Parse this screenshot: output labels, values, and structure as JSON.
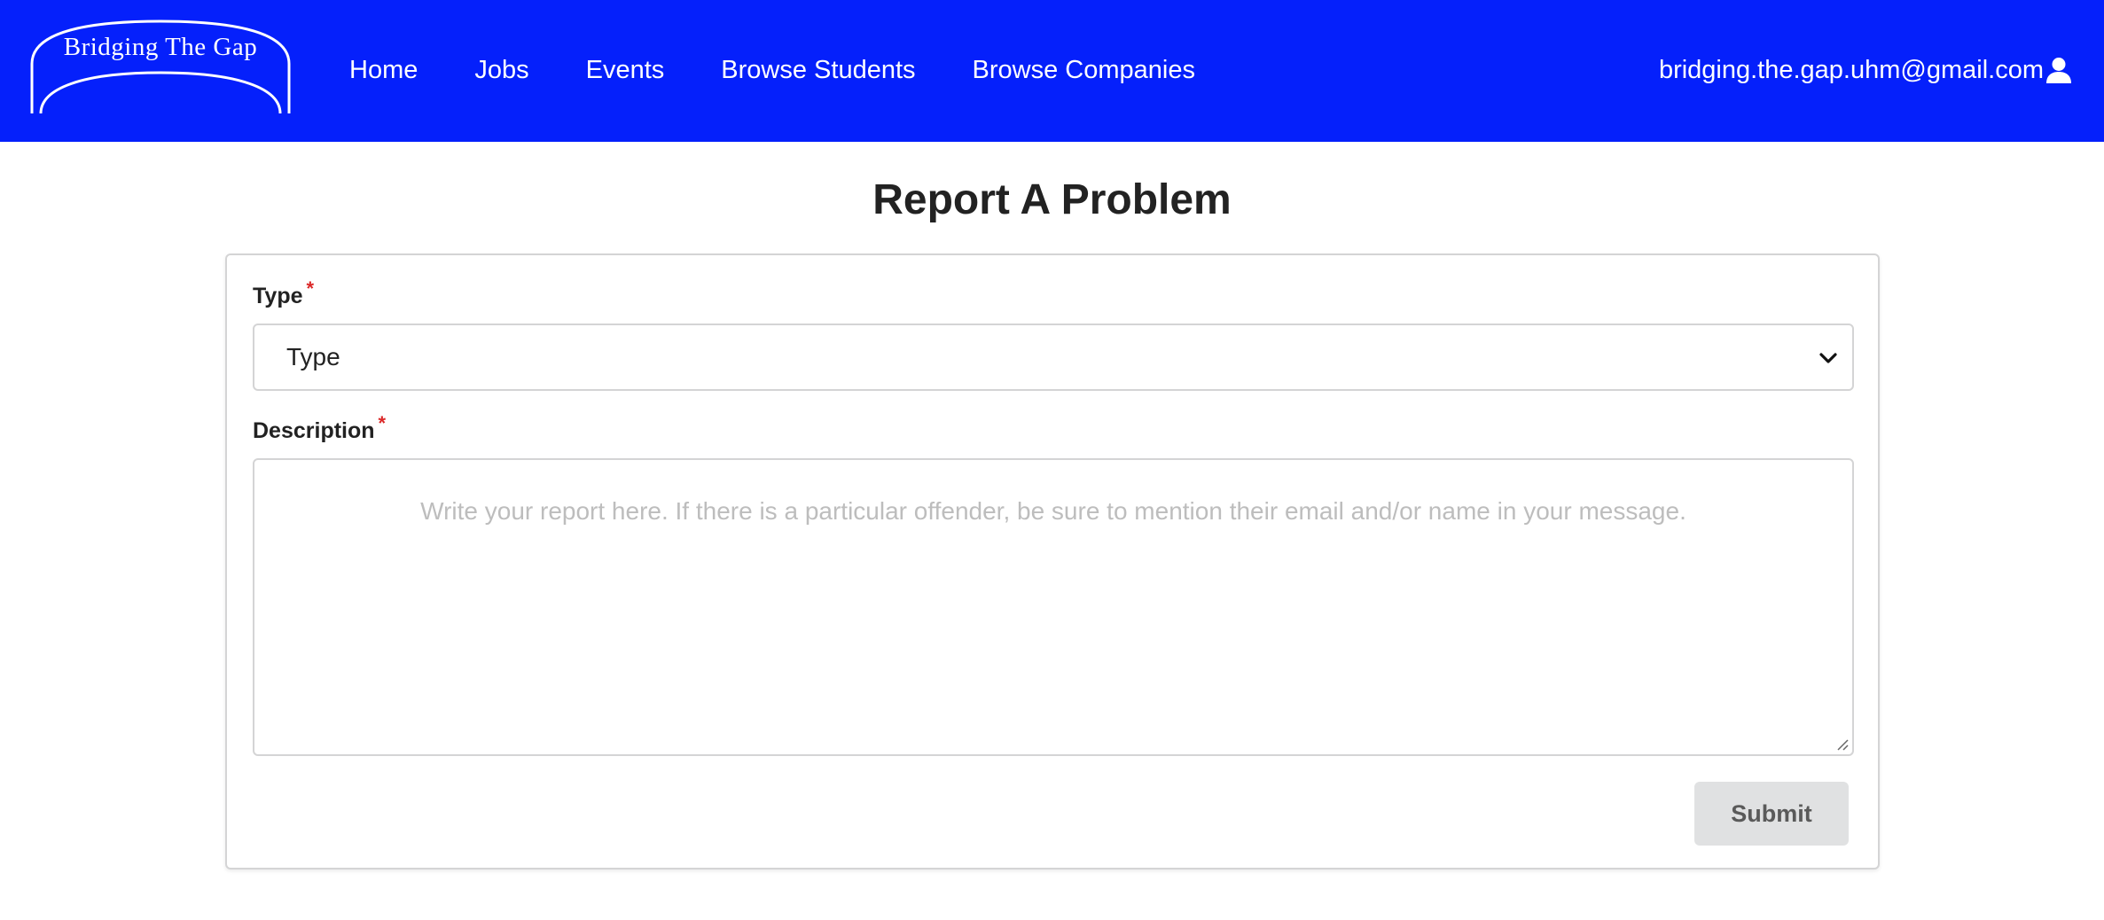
{
  "header": {
    "logo_text": "Bridging The Gap",
    "nav_items": [
      {
        "label": "Home"
      },
      {
        "label": "Jobs"
      },
      {
        "label": "Events"
      },
      {
        "label": "Browse Students"
      },
      {
        "label": "Browse Companies"
      }
    ],
    "user_email": "bridging.the.gap.uhm@gmail.com",
    "user_icon": "user-icon",
    "bg_color": "#0520fb"
  },
  "page": {
    "title": "Report A Problem"
  },
  "form": {
    "type_label": "Type",
    "type_required_mark": "*",
    "type_selected": "Type",
    "type_dropdown_icon": "chevron-down-icon",
    "description_label": "Description",
    "description_required_mark": "*",
    "description_placeholder": "Write your report here. If there is a particular offender, be sure to mention their email and/or name in your message.",
    "submit_label": "Submit"
  }
}
